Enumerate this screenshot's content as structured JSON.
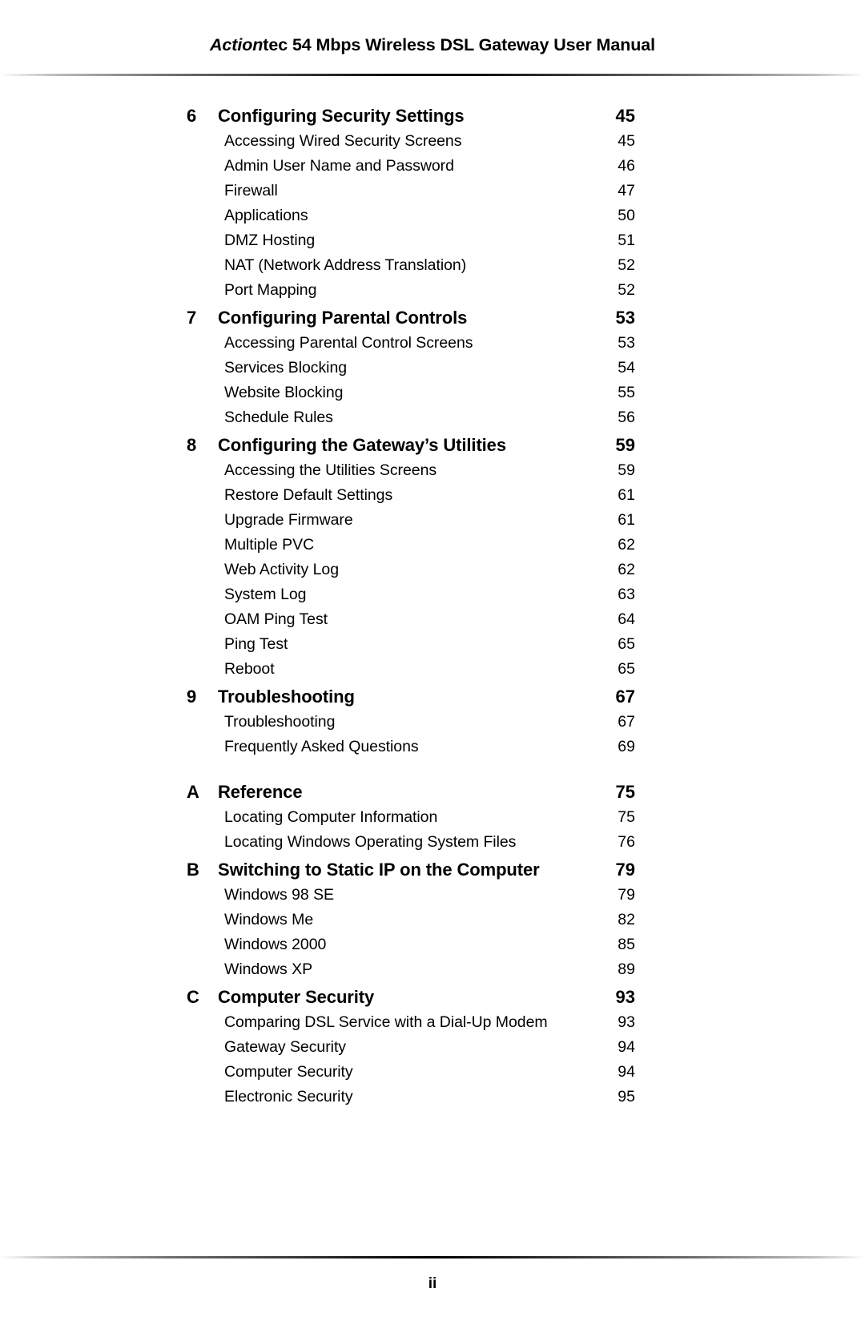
{
  "header": {
    "brand_italic": "Action",
    "brand_rest": "tec 54 Mbps Wireless DSL Gateway User Manual"
  },
  "footer": {
    "page_number": "ii"
  },
  "toc": {
    "rows": [
      {
        "kind": "chapter",
        "number": "6",
        "title": "Configuring Security Settings",
        "page": "45"
      },
      {
        "kind": "entry",
        "number": "",
        "title": "Accessing Wired Security Screens",
        "page": "45"
      },
      {
        "kind": "entry",
        "number": "",
        "title": "Admin User Name and Password",
        "page": "46"
      },
      {
        "kind": "entry",
        "number": "",
        "title": "Firewall",
        "page": "47"
      },
      {
        "kind": "entry",
        "number": "",
        "title": "Applications",
        "page": "50"
      },
      {
        "kind": "entry",
        "number": "",
        "title": "DMZ Hosting",
        "page": "51"
      },
      {
        "kind": "entry",
        "number": "",
        "title": "NAT (Network Address Translation)",
        "page": "52"
      },
      {
        "kind": "entry",
        "number": "",
        "title": "Port Mapping",
        "page": "52"
      },
      {
        "kind": "chapter",
        "number": "7",
        "title": "Configuring Parental Controls",
        "page": "53"
      },
      {
        "kind": "entry",
        "number": "",
        "title": "Accessing Parental Control Screens",
        "page": "53"
      },
      {
        "kind": "entry",
        "number": "",
        "title": "Services Blocking",
        "page": "54"
      },
      {
        "kind": "entry",
        "number": "",
        "title": "Website Blocking",
        "page": "55"
      },
      {
        "kind": "entry",
        "number": "",
        "title": "Schedule Rules",
        "page": "56"
      },
      {
        "kind": "chapter",
        "number": "8",
        "title": "Configuring the Gateway’s Utilities",
        "page": "59"
      },
      {
        "kind": "entry",
        "number": "",
        "title": "Accessing the Utilities Screens",
        "page": "59"
      },
      {
        "kind": "entry",
        "number": "",
        "title": "Restore Default Settings",
        "page": "61"
      },
      {
        "kind": "entry",
        "number": "",
        "title": "Upgrade Firmware",
        "page": "61"
      },
      {
        "kind": "entry",
        "number": "",
        "title": "Multiple PVC",
        "page": "62"
      },
      {
        "kind": "entry",
        "number": "",
        "title": "Web Activity Log",
        "page": "62"
      },
      {
        "kind": "entry",
        "number": "",
        "title": "System Log",
        "page": "63"
      },
      {
        "kind": "entry",
        "number": "",
        "title": "OAM Ping Test",
        "page": "64"
      },
      {
        "kind": "entry",
        "number": "",
        "title": "Ping Test",
        "page": "65"
      },
      {
        "kind": "entry",
        "number": "",
        "title": "Reboot",
        "page": "65"
      },
      {
        "kind": "chapter",
        "number": "9",
        "title": "Troubleshooting",
        "page": "67"
      },
      {
        "kind": "entry",
        "number": "",
        "title": "Troubleshooting",
        "page": "67"
      },
      {
        "kind": "entry",
        "number": "",
        "title": "Frequently Asked Questions",
        "page": "69"
      },
      {
        "kind": "chapter",
        "number": "A",
        "title": "Reference",
        "page": "75",
        "gap_before": true
      },
      {
        "kind": "entry",
        "number": "",
        "title": "Locating Computer Information",
        "page": "75"
      },
      {
        "kind": "entry",
        "number": "",
        "title": "Locating Windows Operating System Files",
        "page": "76"
      },
      {
        "kind": "chapter",
        "number": "B",
        "title": "Switching to Static IP on the Computer",
        "page": "79"
      },
      {
        "kind": "entry",
        "number": "",
        "title": "Windows 98 SE",
        "page": "79"
      },
      {
        "kind": "entry",
        "number": "",
        "title": "Windows Me",
        "page": "82"
      },
      {
        "kind": "entry",
        "number": "",
        "title": "Windows 2000",
        "page": "85"
      },
      {
        "kind": "entry",
        "number": "",
        "title": "Windows XP",
        "page": "89"
      },
      {
        "kind": "chapter",
        "number": "C",
        "title": "Computer Security",
        "page": "93"
      },
      {
        "kind": "entry",
        "number": "",
        "title": "Comparing DSL Service with a Dial-Up Modem",
        "page": "93"
      },
      {
        "kind": "entry",
        "number": "",
        "title": "Gateway Security",
        "page": "94"
      },
      {
        "kind": "entry",
        "number": "",
        "title": "Computer Security",
        "page": "94"
      },
      {
        "kind": "entry",
        "number": "",
        "title": "Electronic Security",
        "page": "95"
      }
    ]
  }
}
